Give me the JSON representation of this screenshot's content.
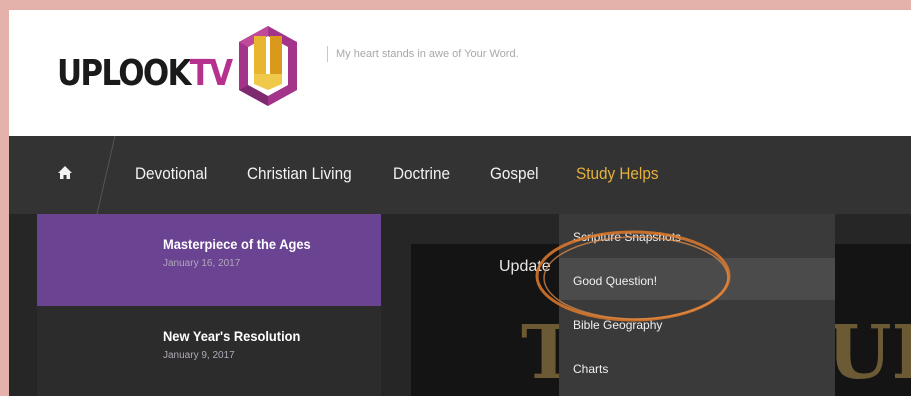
{
  "site": {
    "logo_main": "UPLOOK",
    "logo_tv": "TV",
    "tagline": "My heart stands in awe of Your Word.",
    "colors": {
      "logo_tv": "#b6318d",
      "logo_mark_gold": "#e8b62e",
      "logo_mark_purple": "#a3348a"
    }
  },
  "nav": {
    "home_icon": "home-icon",
    "items": [
      {
        "label": "Devotional",
        "active": false
      },
      {
        "label": "Christian Living",
        "active": false
      },
      {
        "label": "Doctrine",
        "active": false
      },
      {
        "label": "Gospel",
        "active": false
      },
      {
        "label": "Study Helps",
        "active": true
      }
    ],
    "colors": {
      "background": "#333333",
      "active": "#e6b23a"
    }
  },
  "dropdown": {
    "items": [
      {
        "label": "Scripture Snapshots",
        "highlighted": false
      },
      {
        "label": "Good Question!",
        "highlighted": true
      },
      {
        "label": "Bible Geography",
        "highlighted": false
      },
      {
        "label": "Charts",
        "highlighted": false
      }
    ],
    "annotation_color": "#e07a2c"
  },
  "posts": [
    {
      "title": "Masterpiece of the Ages",
      "date": "January 16, 2017",
      "active": true
    },
    {
      "title": "New Year's Resolution",
      "date": "January 9, 2017",
      "active": false
    }
  ],
  "feature": {
    "update_label": "Update",
    "visible_letters_left": "T",
    "visible_letters_right": "UR"
  }
}
